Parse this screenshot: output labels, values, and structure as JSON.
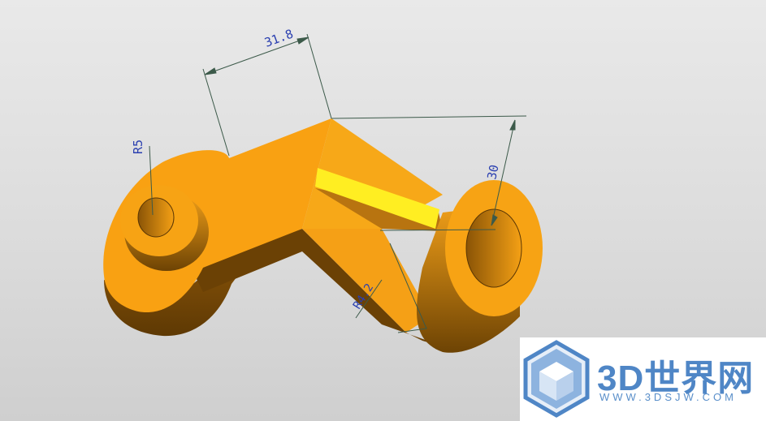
{
  "dimensions": {
    "top_distance": "31.8",
    "left_radius": "R5",
    "right_height": "30",
    "bottom_radius": "R4.2"
  },
  "watermark": {
    "logo_icon": "cube-hexagon-logo-icon",
    "title": "3D世界网",
    "url": "WWW.3DSJW.COM",
    "color": "#4f86c6"
  },
  "colors": {
    "part": "#f7a414",
    "part_shadow": "#7a4a06",
    "highlight": "#ffee22",
    "background": "#dcdcdc"
  }
}
